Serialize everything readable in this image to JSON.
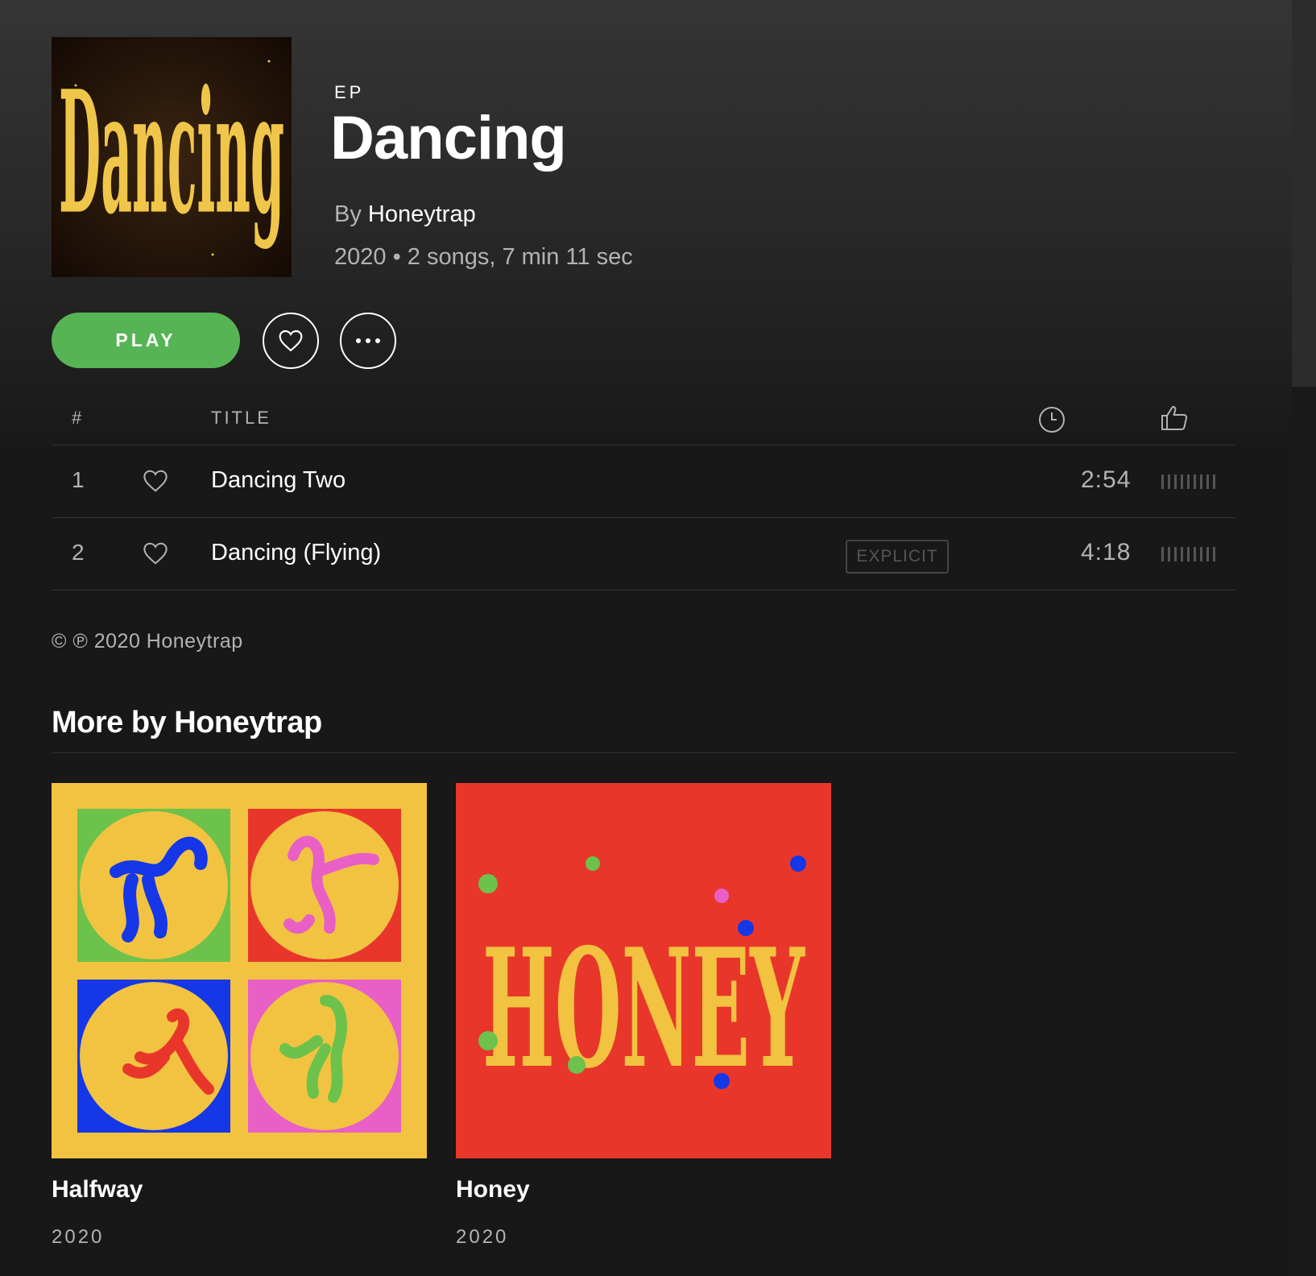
{
  "album": {
    "type_label": "EP",
    "title": "Dancing",
    "by_prefix": "By",
    "artist": "Honeytrap",
    "meta": "2020 • 2 songs, 7 min 11 sec",
    "cover_text": "Dancing"
  },
  "actions": {
    "play_label": "PLAY"
  },
  "tracklist": {
    "headers": {
      "number": "#",
      "title": "TITLE"
    },
    "tracks": [
      {
        "number": "1",
        "title": "Dancing Two",
        "duration": "2:54",
        "explicit": false,
        "popularity": 0.0
      },
      {
        "number": "2",
        "title": "Dancing (Flying)",
        "duration": "4:18",
        "explicit": true,
        "popularity": 0.0
      }
    ],
    "explicit_label": "EXPLICIT"
  },
  "copyright": "© ℗ 2020 Honeytrap",
  "more": {
    "title": "More by Honeytrap",
    "albums": [
      {
        "title": "Halfway",
        "year": "2020"
      },
      {
        "title": "Honey",
        "year": "2020",
        "cover_text": "HONEY"
      }
    ]
  },
  "colors": {
    "play_green": "#56b454",
    "background": "#181818",
    "text_muted": "#b3b3b3"
  },
  "icons": [
    "heart-icon",
    "more-dots-icon",
    "clock-icon",
    "thumbs-up-icon"
  ]
}
